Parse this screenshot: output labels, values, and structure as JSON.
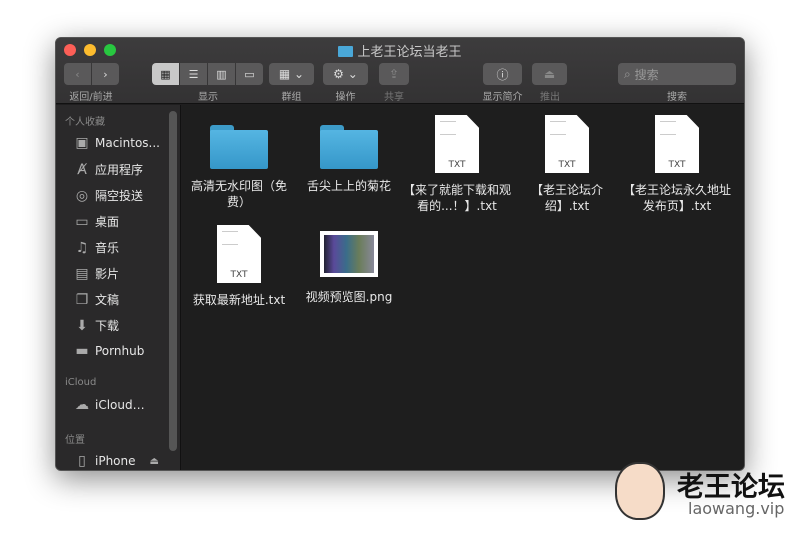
{
  "window": {
    "title": "上老王论坛当老王"
  },
  "toolbar": {
    "nav_label": "返回/前进",
    "view_label": "显示",
    "group_label": "群组",
    "action_label": "操作",
    "share_label": "共享",
    "info_label": "显示简介",
    "eject_label": "推出",
    "search_label": "搜索",
    "search_placeholder": "搜索"
  },
  "sidebar": {
    "favorites_header": "个人收藏",
    "favorites": [
      {
        "label": "Macintos...",
        "icon": "disk-icon"
      },
      {
        "label": "应用程序",
        "icon": "apps-icon"
      },
      {
        "label": "隔空投送",
        "icon": "airdrop-icon"
      },
      {
        "label": "桌面",
        "icon": "desktop-icon"
      },
      {
        "label": "音乐",
        "icon": "music-icon"
      },
      {
        "label": "影片",
        "icon": "movies-icon"
      },
      {
        "label": "文稿",
        "icon": "documents-icon"
      },
      {
        "label": "下载",
        "icon": "downloads-icon"
      },
      {
        "label": "Pornhub",
        "icon": "folder-icon"
      }
    ],
    "icloud_header": "iCloud",
    "icloud": [
      {
        "label": "iCloud…",
        "icon": "cloud-icon"
      }
    ],
    "locations_header": "位置",
    "locations": [
      {
        "label": "iPhone",
        "icon": "phone-icon"
      }
    ]
  },
  "files": [
    {
      "name": "高清无水印图（免费）",
      "type": "folder"
    },
    {
      "name": "舌尖上上的菊花",
      "type": "folder"
    },
    {
      "name": "【来了就能下载和观看的...！】.txt",
      "type": "txt",
      "badge": "TXT"
    },
    {
      "name": "【老王论坛介绍】.txt",
      "type": "txt",
      "badge": "TXT"
    },
    {
      "name": "【老王论坛永久地址发布页】.txt",
      "type": "txt",
      "badge": "TXT"
    },
    {
      "name": "获取最新地址.txt",
      "type": "txt",
      "badge": "TXT"
    },
    {
      "name": "视频预览图.png",
      "type": "png"
    }
  ],
  "watermark": {
    "brand": "老王论坛",
    "url": "laowang.vip"
  }
}
